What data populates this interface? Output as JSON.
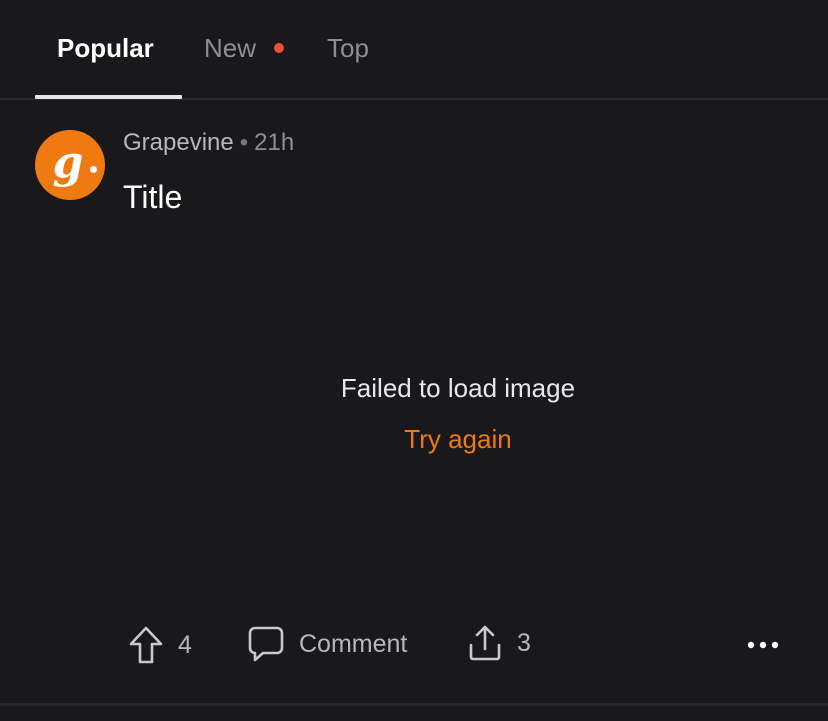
{
  "tabs": {
    "popular": "Popular",
    "new": "New",
    "top": "Top"
  },
  "post": {
    "community": "Grapevine",
    "separator": "•",
    "age": "21h",
    "title": "Title",
    "avatar_letter": "g",
    "image_error": "Failed to load image",
    "retry_label": "Try again"
  },
  "actions": {
    "upvotes": "4",
    "comment_label": "Comment",
    "shares": "3"
  },
  "colors": {
    "background": "#19181b",
    "accent": "#f07a12",
    "notification_dot": "#ea4f3a"
  }
}
